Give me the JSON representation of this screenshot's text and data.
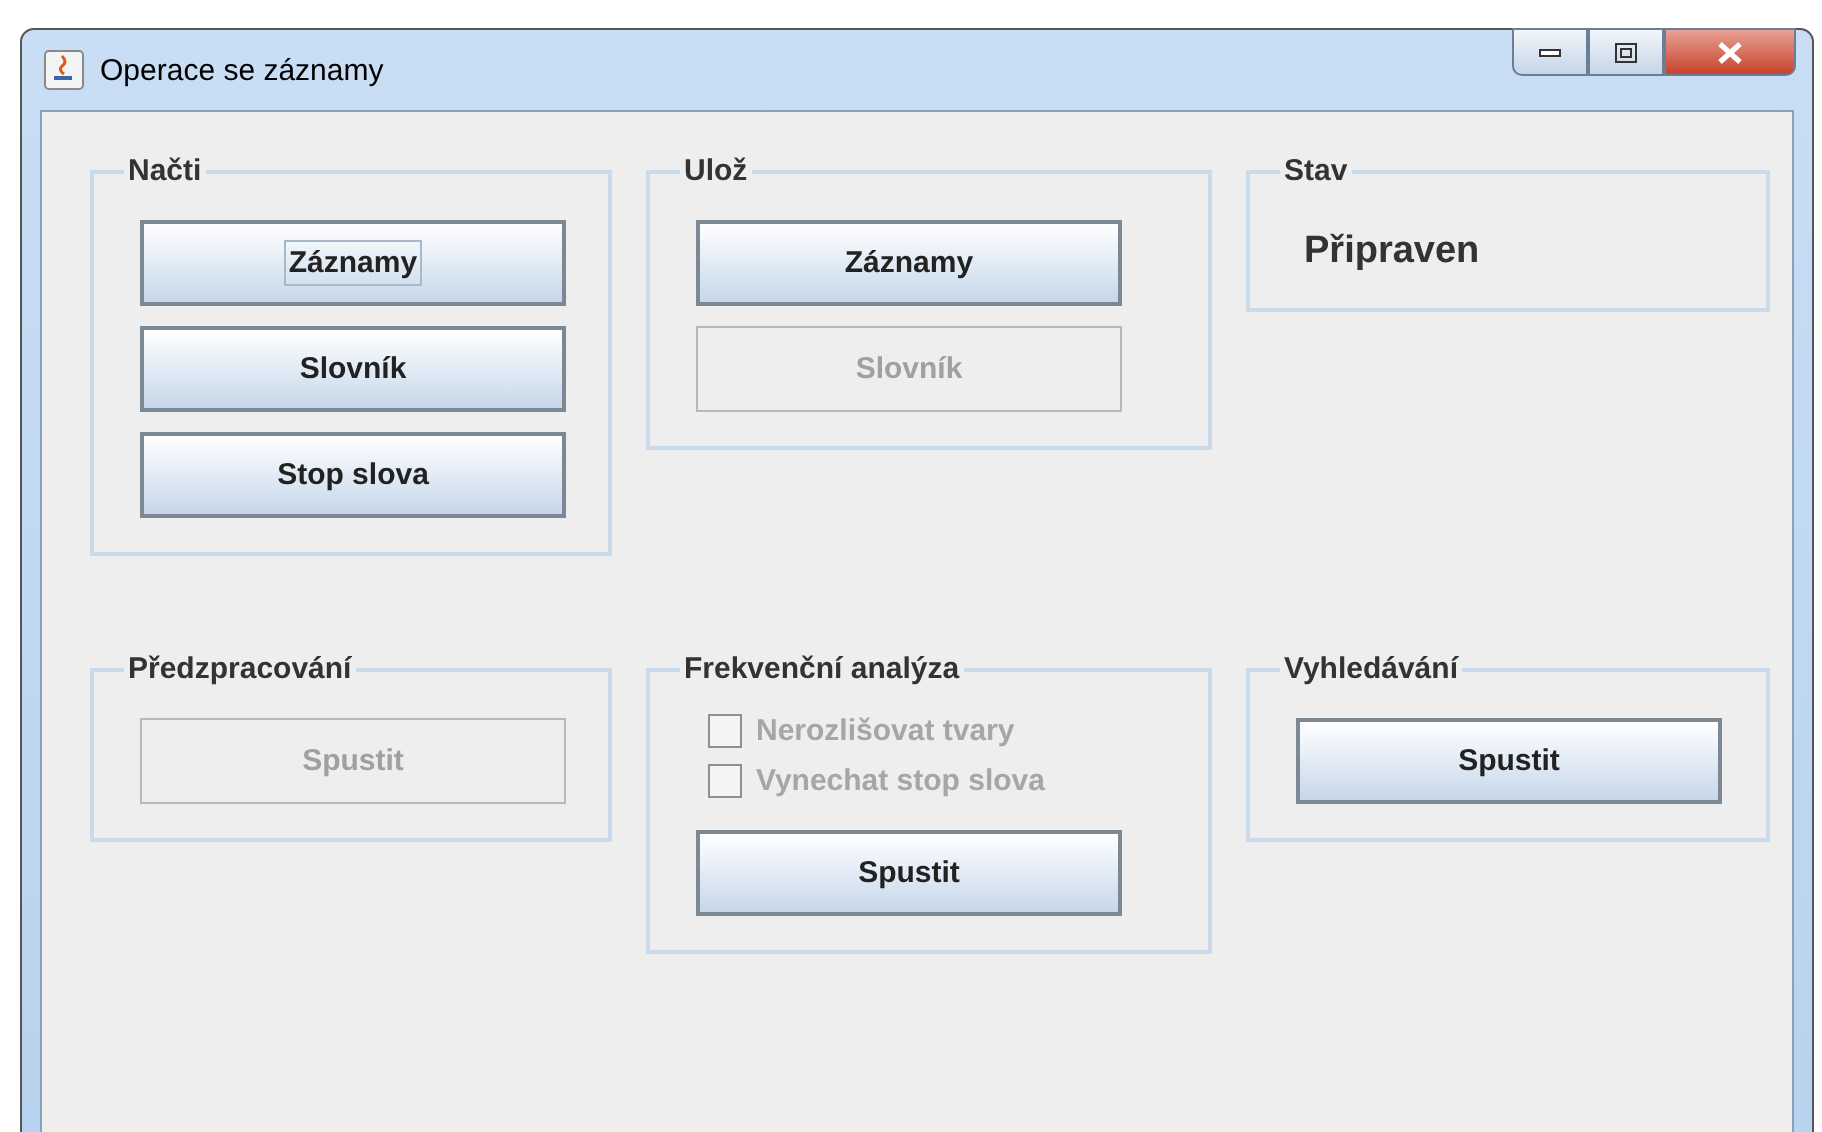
{
  "window": {
    "title": "Operace se záznamy"
  },
  "groups": [
    {
      "title": "Načti",
      "items": [
        {
          "kind": "button",
          "label": "Záznamy",
          "disabled": false,
          "focused": true
        },
        {
          "kind": "button",
          "label": "Slovník",
          "disabled": false,
          "focused": false
        },
        {
          "kind": "button",
          "label": "Stop slova",
          "disabled": false,
          "focused": false
        }
      ]
    },
    {
      "title": "Ulož",
      "items": [
        {
          "kind": "button",
          "label": "Záznamy",
          "disabled": false,
          "focused": false
        },
        {
          "kind": "button",
          "label": "Slovník",
          "disabled": true,
          "focused": false
        }
      ]
    },
    {
      "title": "Stav",
      "items": [
        {
          "kind": "status",
          "label": "Připraven"
        }
      ]
    },
    {
      "title": "Předzpracování",
      "items": [
        {
          "kind": "button",
          "label": "Spustit",
          "disabled": true,
          "focused": false
        }
      ]
    },
    {
      "title": "Frekvenční analýza",
      "items": [
        {
          "kind": "checkbox",
          "label": "Nerozlišovat tvary",
          "checked": false,
          "disabled": true
        },
        {
          "kind": "checkbox",
          "label": "Vynechat stop slova",
          "checked": false,
          "disabled": true
        },
        {
          "kind": "button",
          "label": "Spustit",
          "disabled": false,
          "focused": false
        }
      ]
    },
    {
      "title": "Vyhledávání",
      "items": [
        {
          "kind": "button",
          "label": "Spustit",
          "disabled": false,
          "focused": false
        }
      ]
    }
  ]
}
